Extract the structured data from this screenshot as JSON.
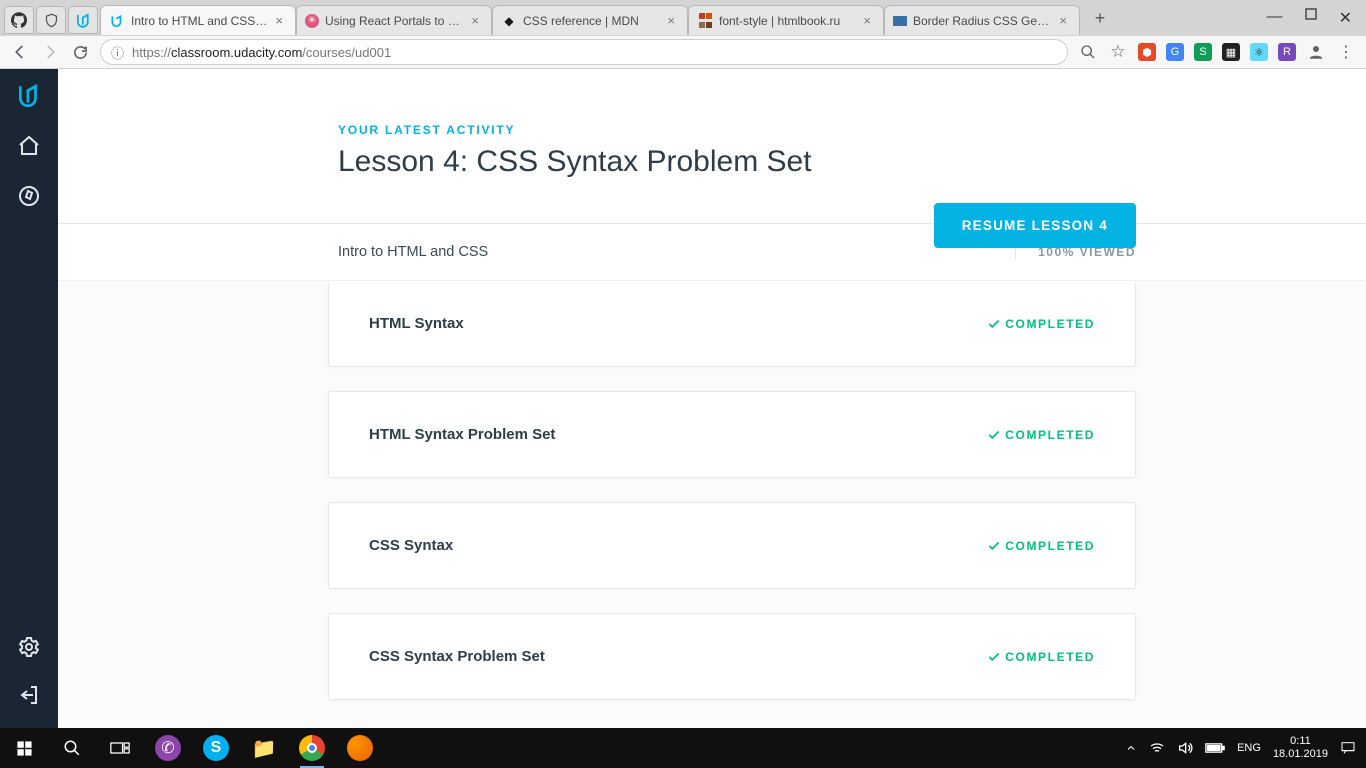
{
  "browser": {
    "tabs": [
      {
        "title": "Intro to HTML and CSS - U"
      },
      {
        "title": "Using React Portals to Ren"
      },
      {
        "title": "CSS reference | MDN"
      },
      {
        "title": "font-style | htmlbook.ru"
      },
      {
        "title": "Border Radius CSS Genera"
      }
    ],
    "url_display": "https://classroom.udacity.com/courses/ud001",
    "url_host": "classroom.udacity.com",
    "url_path": "/courses/ud001"
  },
  "page": {
    "eyebrow": "YOUR LATEST ACTIVITY",
    "lesson_title": "Lesson 4: CSS Syntax Problem Set",
    "resume_label": "RESUME LESSON 4",
    "course_name": "Intro to HTML and CSS",
    "progress_text": "100% VIEWED",
    "status_label": "COMPLETED",
    "lessons": [
      {
        "title": "HTML Syntax"
      },
      {
        "title": "HTML Syntax Problem Set"
      },
      {
        "title": "CSS Syntax"
      },
      {
        "title": "CSS Syntax Problem Set"
      }
    ]
  },
  "taskbar": {
    "lang": "ENG",
    "time": "0:11",
    "date": "18.01.2019"
  }
}
